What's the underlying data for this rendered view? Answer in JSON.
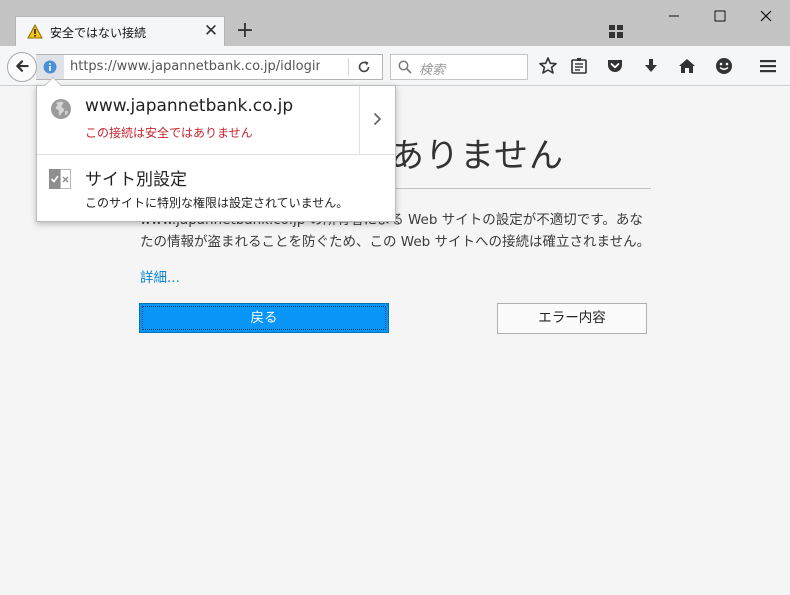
{
  "tab": {
    "title": "安全ではない接続",
    "close_glyph": "✕",
    "new_tab_glyph": "+"
  },
  "window_controls": {
    "minimize": "—",
    "maximize": "☐",
    "close": "✕"
  },
  "navbar": {
    "url": "https://www.japannetbank.co.jp/idlogin.ht",
    "search_placeholder": "検索",
    "icons": [
      "back-arrow-icon",
      "info-icon",
      "reload-icon",
      "search-icon",
      "star-icon",
      "reading-list-icon",
      "pocket-icon",
      "download-icon",
      "home-icon",
      "smiley-icon",
      "menu-icon"
    ]
  },
  "page": {
    "title": "ありません",
    "description": "www.japannetbank.co.jp の所有者による Web サイトの設定が不適切です。あなたの情報が盗まれることを防ぐため、この Web サイトへの接続は確立されません。",
    "advanced_link": "詳細...",
    "back_button": "戻る",
    "error_button": "エラー内容"
  },
  "popup": {
    "host": "www.japannetbank.co.jp",
    "insecure_text": "この接続は安全ではありません",
    "permissions_title": "サイト別設定",
    "permissions_desc": "このサイトに特別な権限は設定されていません。"
  },
  "colors": {
    "accent_blue": "#0996f8",
    "insecure_red": "#c7242f",
    "link_blue": "#0a84d0",
    "titlebar_gray": "#c4c4c4"
  }
}
